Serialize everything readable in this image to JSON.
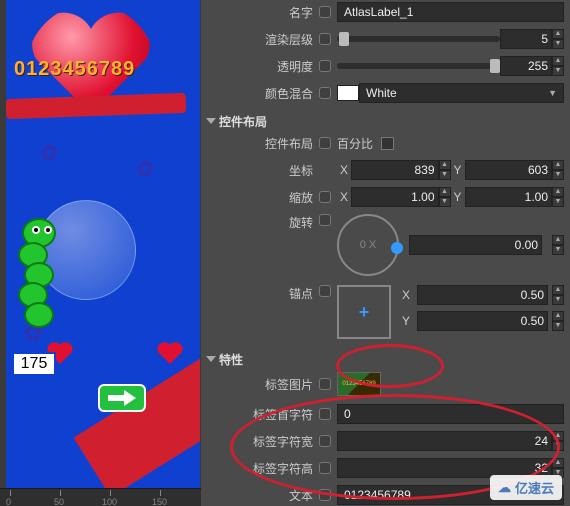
{
  "preview": {
    "digits": "0123456789",
    "badge": "175",
    "ruler": [
      "0",
      "50",
      "100",
      "150"
    ]
  },
  "props": {
    "name": {
      "label": "名字",
      "value": "AtlasLabel_1"
    },
    "zorder": {
      "label": "渲染层级",
      "value": "5"
    },
    "opacity": {
      "label": "透明度",
      "value": "255"
    },
    "blend": {
      "label": "颜色混合",
      "value": "White"
    }
  },
  "layout": {
    "title": "控件布局",
    "layout_label": "控件布局",
    "percent": "百分比",
    "coord": {
      "label": "坐标",
      "x": "839",
      "y": "603"
    },
    "scale": {
      "label": "缩放",
      "x": "1.00",
      "y": "1.00"
    },
    "rotate": {
      "label": "旋转",
      "center": "0 X",
      "value": "0.00"
    },
    "anchor": {
      "label": "锚点",
      "x": "0.50",
      "y": "0.50"
    },
    "X": "X",
    "Y": "Y"
  },
  "feature": {
    "title": "特性",
    "image": {
      "label": "标签图片",
      "thumb_text": "0123456789"
    },
    "firstchar": {
      "label": "标签首字符",
      "value": "0"
    },
    "charwidth": {
      "label": "标签字符宽",
      "value": "24"
    },
    "charheight": {
      "label": "标签字符高",
      "value": "32"
    },
    "text": {
      "label": "文本",
      "value": "0123456789"
    }
  },
  "watermark": "亿速云"
}
